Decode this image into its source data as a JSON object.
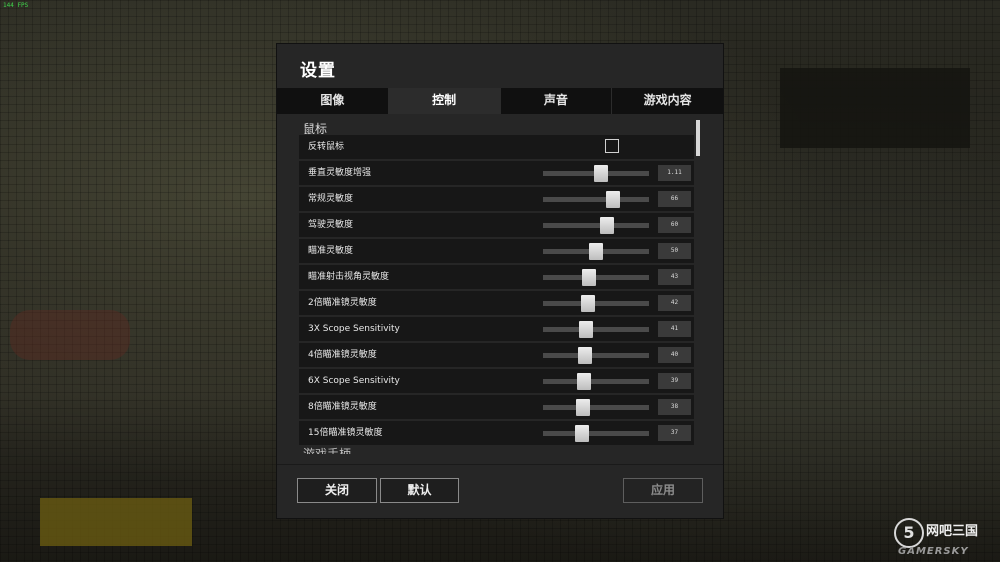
{
  "fps": "144 FPS",
  "dialog": {
    "title": "设置",
    "tabs": [
      {
        "label": "图像",
        "active": false
      },
      {
        "label": "控制",
        "active": true
      },
      {
        "label": "声音",
        "active": false
      },
      {
        "label": "游戏内容",
        "active": false
      }
    ],
    "section_title": "鼠标",
    "invert_mouse": {
      "label": "反转鼠标",
      "checked": false
    },
    "sliders": [
      {
        "label": "垂直灵敏度增强",
        "value": "1.11",
        "fraction": 0.55
      },
      {
        "label": "常规灵敏度",
        "value": "66",
        "fraction": 0.66
      },
      {
        "label": "驾驶灵敏度",
        "value": "60",
        "fraction": 0.6
      },
      {
        "label": "瞄准灵敏度",
        "value": "50",
        "fraction": 0.5
      },
      {
        "label": "瞄准射击视角灵敏度",
        "value": "43",
        "fraction": 0.43
      },
      {
        "label": "2倍瞄准镜灵敏度",
        "value": "42",
        "fraction": 0.42
      },
      {
        "label": "3X Scope Sensitivity",
        "value": "41",
        "fraction": 0.41
      },
      {
        "label": "4倍瞄准镜灵敏度",
        "value": "40",
        "fraction": 0.4
      },
      {
        "label": "6X Scope Sensitivity",
        "value": "39",
        "fraction": 0.39
      },
      {
        "label": "8倍瞄准镜灵敏度",
        "value": "38",
        "fraction": 0.38
      },
      {
        "label": "15倍瞄准镜灵敏度",
        "value": "37",
        "fraction": 0.37
      }
    ],
    "next_section_peek": "游戏手柄",
    "buttons": {
      "close": "关闭",
      "default": "默认",
      "apply": "应用"
    }
  },
  "watermark": {
    "circle": "5",
    "cn": "网吧三国",
    "en": "GAMERSKY"
  },
  "colors": {
    "panel": "#262626",
    "row": "#171717",
    "tab_inactive": "#101010",
    "fps": "#3fd24a"
  }
}
